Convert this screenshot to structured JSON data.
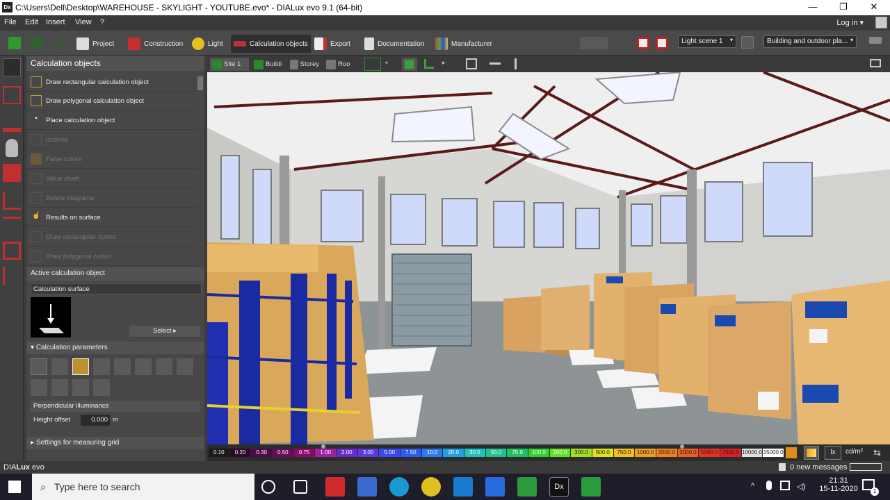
{
  "window": {
    "icon_text": "Dx",
    "title": "C:\\Users\\Dell\\Desktop\\WAREHOUSE - SKYLIGHT - YOUTUBE.evo* - DIALux evo 9.1  (64-bit)",
    "minimize": "—",
    "maximize": "❐",
    "close": "✕"
  },
  "menu": {
    "items": [
      "File",
      "Edit",
      "Insert",
      "View",
      "?"
    ],
    "login": "Log in",
    "login_arrow": "▾"
  },
  "toolbar": {
    "tabs": [
      "Project",
      "Construction",
      "Light",
      "Calculation objects",
      "Export",
      "Documentation",
      "Manufacturer"
    ],
    "light_scene": "Light scene 1",
    "view_mode": "Building and outdoor pla...",
    "dd_arrow": "▾"
  },
  "panel": {
    "title": "Calculation objects",
    "items": [
      {
        "label": "Draw rectangular calculation object",
        "enabled": true
      },
      {
        "label": "Draw polygonal calculation object",
        "enabled": true
      },
      {
        "label": "Place calculation object",
        "enabled": true
      },
      {
        "label": "Isolines",
        "enabled": false
      },
      {
        "label": "False colors",
        "enabled": false
      },
      {
        "label": "Value chart",
        "enabled": false
      },
      {
        "label": "Delete diagrams",
        "enabled": false
      },
      {
        "label": "Results on surface",
        "enabled": true
      },
      {
        "label": "Draw rectangular cutout",
        "enabled": false
      },
      {
        "label": "Draw polygonal cutout",
        "enabled": false
      }
    ],
    "active_title": "Active calculation object",
    "active_object": "Calculation surface",
    "select_label": "Select",
    "select_arrow": "▸",
    "params_title": "Calculation parameters",
    "param_type": "Perpendicular illuminance",
    "height_offset_label": "Height offset",
    "height_offset_value": "0.000",
    "height_offset_unit": "m",
    "grid_title": "Settings for measuring grid"
  },
  "viewtabs": {
    "items": [
      "Site 1",
      "Buildi",
      "Storey",
      "Roo"
    ]
  },
  "scale": {
    "values": [
      "0.10",
      "0.20",
      "0.30",
      "0.50",
      "0.75",
      "1.00",
      "2.00",
      "3.00",
      "5.00",
      "7.50",
      "10.0",
      "20.0",
      "30.0",
      "50.0",
      "75.0",
      "100.0",
      "200.0",
      "300.0",
      "500.0",
      "750.0",
      "1000.0",
      "2000.0",
      "3000.0",
      "5000.0",
      "7500.0",
      "10000.0",
      "15000.0"
    ],
    "colors": [
      "#1a1a1a",
      "#2a0a2a",
      "#4a0a4a",
      "#6a0a5a",
      "#8a0a6a",
      "#a020a0",
      "#6a2ad0",
      "#5a3ae0",
      "#3a4af0",
      "#2a5af0",
      "#2a7af0",
      "#20a0e0",
      "#20c0c0",
      "#20c090",
      "#20c060",
      "#30d030",
      "#60e020",
      "#a0e020",
      "#e0e020",
      "#f0c020",
      "#f0a020",
      "#f08020",
      "#f06020",
      "#f03020",
      "#e02020",
      "#e0e0e0",
      "#ffffff"
    ],
    "unit_lx": "lx",
    "unit_cd": "cd/m²"
  },
  "status": {
    "brand_prefix": "DIA",
    "brand_mid": "Lux",
    "brand_suffix": " evo",
    "messages": "0 new messages"
  },
  "taskbar": {
    "search_placeholder": "Type here to search",
    "time": "21:31",
    "date": "15-11-2020",
    "notif_count": "1"
  }
}
